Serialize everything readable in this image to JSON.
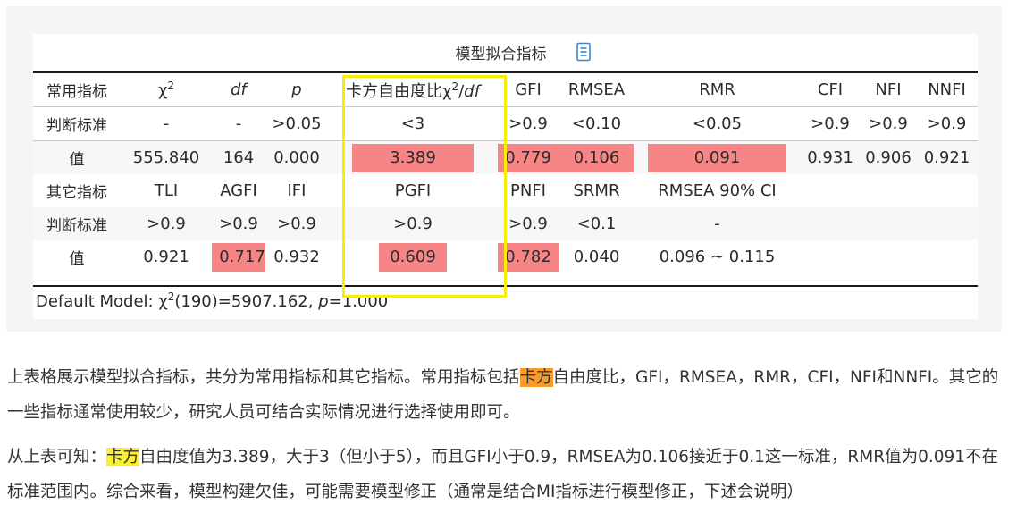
{
  "table": {
    "title": "模型拟合指标",
    "columns": [
      {
        "label": "常用指标"
      },
      {
        "label": "χ2"
      },
      {
        "label": "df"
      },
      {
        "label": "p"
      },
      {
        "label": "卡方自由度比χ2/df"
      },
      {
        "label": "GFI"
      },
      {
        "label": "RMSEA"
      },
      {
        "label": "RMR"
      },
      {
        "label": "CFI"
      },
      {
        "label": "NFI"
      },
      {
        "label": "NNFI"
      }
    ],
    "rows": [
      {
        "label": "判断标准",
        "cells": [
          "-",
          "-",
          ">0.05",
          "<3",
          ">0.9",
          "<0.10",
          "<0.05",
          ">0.9",
          ">0.9",
          ">0.9"
        ]
      },
      {
        "label": "值",
        "cells": [
          "555.840",
          "164",
          "0.000",
          "3.389",
          "0.779",
          "0.106",
          "0.091",
          "0.931",
          "0.906",
          "0.921"
        ],
        "highlighted": [
          "3.389",
          "0.779",
          "0.106",
          "0.091"
        ]
      },
      {
        "label": "其它指标",
        "cells": [
          "TLI",
          "AGFI",
          "IFI",
          "PGFI",
          "PNFI",
          "SRMR",
          "RMSEA 90% CI"
        ]
      },
      {
        "label": "判断标准",
        "cells": [
          ">0.9",
          ">0.9",
          ">0.9",
          ">0.9",
          ">0.9",
          "<0.1",
          "-"
        ]
      },
      {
        "label": "值",
        "cells": [
          "0.921",
          "0.717",
          "0.932",
          "0.609",
          "0.782",
          "0.040",
          "0.096 ~ 0.115"
        ],
        "highlighted": [
          "0.717",
          "0.609",
          "0.782"
        ]
      }
    ],
    "footnote": "Default Model: χ2(190)=5907.162, p=1.000",
    "highlight_color": "#f78586",
    "box_color": "#f6ee09"
  },
  "paragraph1": {
    "before": "上表格展示模型拟合指标，共分为常用指标和其它指标。常用指标包括",
    "mark": "卡方",
    "after": "自由度比，GFI，RMSEA，RMR，CFI，NFI和NNFI。其它的一些指标通常使用较少，研究人员可结合实际情况进行选择使用即可。"
  },
  "paragraph2": {
    "before": "从上表可知：",
    "mark": "卡方",
    "after": "自由度值为3.389，大于3（但小于5），而且GFI小于0.9，RMSEA为0.106接近于0.1这一标准，RMR值为0.091不在标准范围内。综合来看，模型构建欠佳，可能需要模型修正（通常是结合MI指标进行模型修正，下述会说明）"
  }
}
